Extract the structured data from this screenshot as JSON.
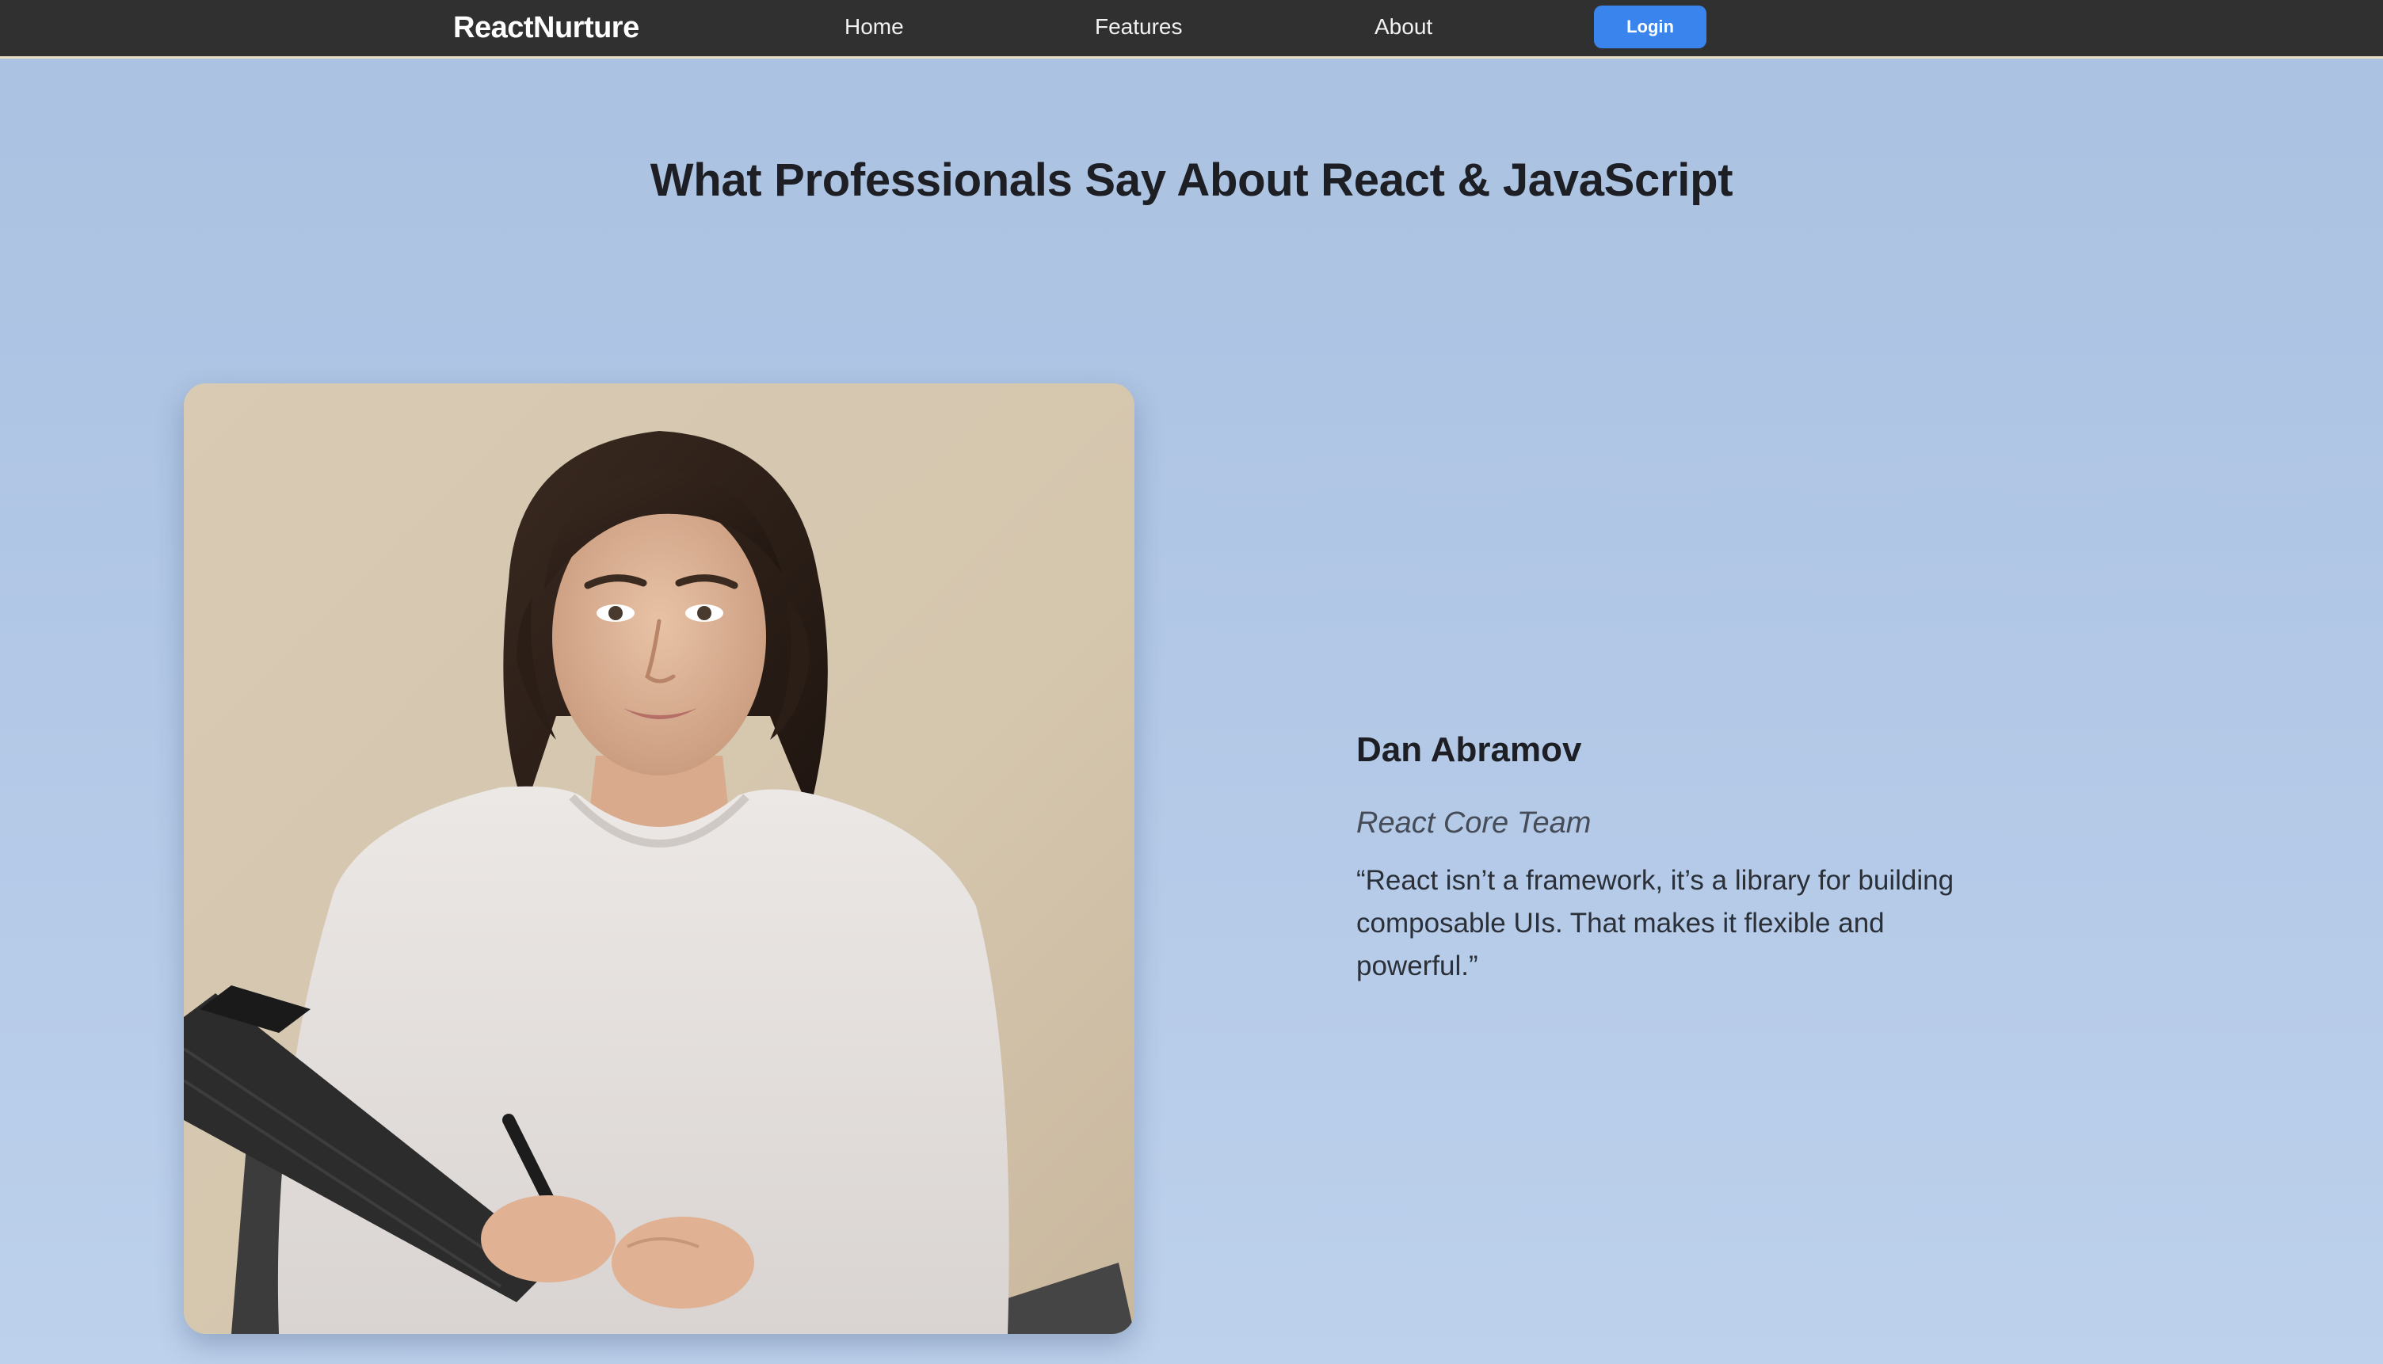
{
  "nav": {
    "brand": "ReactNurture",
    "links": [
      "Home",
      "Features",
      "About"
    ],
    "login_label": "Login"
  },
  "hero": {
    "title": "What Professionals Say About React & JavaScript"
  },
  "testimonial": {
    "photo_icon": "portrait-photo",
    "name": "Dan Abramov",
    "role": "React Core Team",
    "quote": "“React isn’t a framework, it’s a library for building composable UIs. That makes it flexible and powerful.”"
  },
  "colors": {
    "navbar_bg": "#303030",
    "accent": "#3a84ee",
    "page_bg_top": "#aac1e1",
    "page_bg_bottom": "#bdd1ec",
    "heading_text": "#1d1f24"
  }
}
